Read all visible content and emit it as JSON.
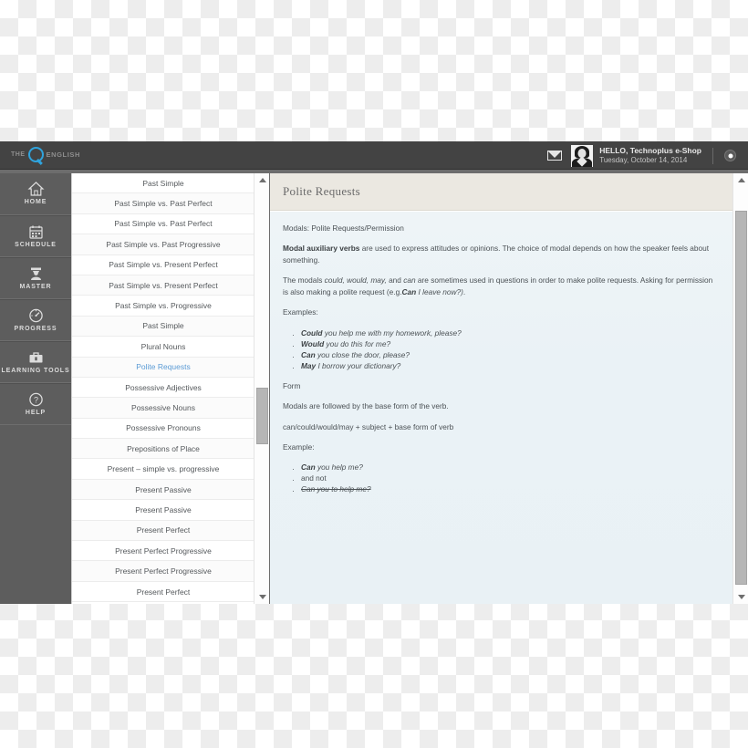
{
  "app": {
    "logo": {
      "pre": "THE",
      "mark": "Q",
      "post": "ENGLISH"
    }
  },
  "topbar": {
    "mail_icon": "mail-icon",
    "greeting": "HELLO, Technoplus e-Shop",
    "date": "Tuesday, October 14, 2014",
    "settings_icon": "gear-icon"
  },
  "sidebar": {
    "items": [
      {
        "label": "HOME",
        "icon": "home-icon"
      },
      {
        "label": "SCHEDULE",
        "icon": "calendar-icon"
      },
      {
        "label": "MASTER",
        "icon": "graduate-icon"
      },
      {
        "label": "PROGRESS",
        "icon": "gauge-icon"
      },
      {
        "label": "LEARNING TOOLS",
        "icon": "toolbox-icon"
      },
      {
        "label": "HELP",
        "icon": "question-icon"
      }
    ]
  },
  "lesson_list": {
    "active": "Polite Requests",
    "items": [
      "Past Simple",
      "Past Simple vs. Past Perfect",
      "Past Simple vs. Past Perfect",
      "Past Simple vs. Past Progressive",
      "Past Simple vs. Present Perfect",
      "Past Simple vs. Present Perfect",
      "Past Simple vs. Progressive",
      "Past Simple",
      "Plural Nouns",
      "Polite Requests",
      "Possessive Adjectives",
      "Possessive Nouns",
      "Possessive Pronouns",
      "Prepositions of Place",
      "Present – simple vs. progressive",
      "Present Passive",
      "Present Passive",
      "Present Perfect",
      "Present Perfect Progressive",
      "Present Perfect Progressive",
      "Present Perfect"
    ]
  },
  "content": {
    "title": "Polite Requests",
    "subtitle": "Modals: Polite Requests/Permission",
    "para1_bold": "Modal auxiliary verbs",
    "para1_rest": " are used to express attitudes or opinions. The choice of modal depends on how the speaker feels about something.",
    "para2_a": "The modals ",
    "para2_modals": "could, would, may,",
    "para2_b": " and ",
    "para2_can": "can",
    "para2_c": " are sometimes used in questions in order to make polite requests. Asking for permission is also making a polite request (e.g.",
    "para2_eg_bold": "Can",
    "para2_eg_ital": " I leave now?)",
    "para2_d": ".",
    "examples_label": "Examples:",
    "examples": [
      {
        "modal": "Could",
        "rest": " you help me with my homework, please?"
      },
      {
        "modal": "Would",
        "rest": " you do this for me?"
      },
      {
        "modal": "Can",
        "rest": " you close the door, please?"
      },
      {
        "modal": "May",
        "rest": " I borrow your dictionary?"
      }
    ],
    "form_label": "Form",
    "form_text": "Modals are followed by the base form of the verb.",
    "formula": "can/could/would/may + subject + base form of verb",
    "example_label": "Example:",
    "example_ok_modal": "Can",
    "example_ok_rest": " you help me?",
    "example_and_not": "and not",
    "example_wrong": "Can you to help me?"
  },
  "scrollbars": {
    "up_arrow": "scroll-up-arrow",
    "down_arrow": "scroll-down-arrow"
  },
  "colors": {
    "accent_blue": "#2fa3dd",
    "active_link": "#5b9bd5",
    "topbar": "#434343",
    "sidebar": "#5d5d5d",
    "content_bg": "#eaf2f6",
    "header_bg": "#ebe8e1"
  }
}
